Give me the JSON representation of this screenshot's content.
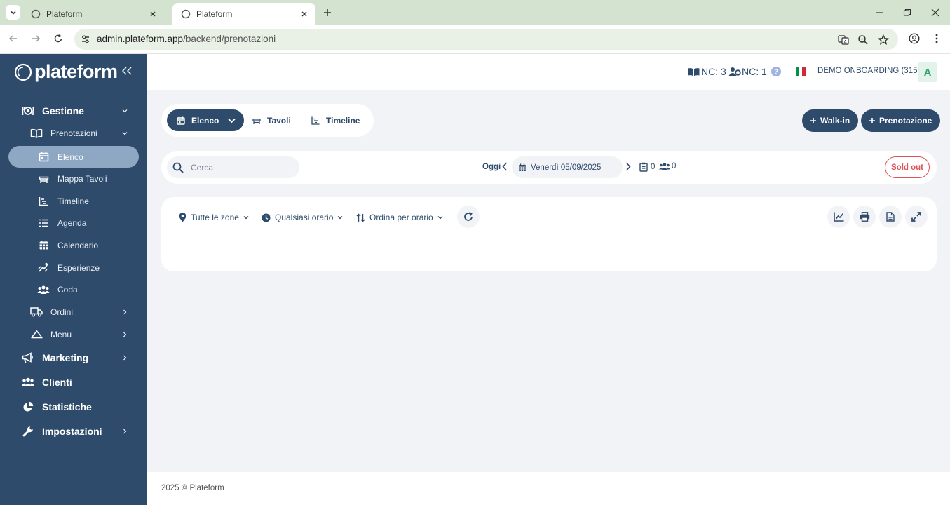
{
  "browser": {
    "tabs": [
      {
        "title": "Plateform"
      },
      {
        "title": "Plateform"
      }
    ],
    "url_host": "admin.plateform.app",
    "url_path": "/backend/prenotazioni"
  },
  "sidebar": {
    "logo": "plateform",
    "items": [
      {
        "label": "Gestione",
        "icon": "cutlery-icon"
      },
      {
        "label": "Prenotazioni",
        "icon": "book-icon"
      },
      {
        "label": "Elenco",
        "icon": "calendar-icon"
      },
      {
        "label": "Mappa Tavoli",
        "icon": "table-icon"
      },
      {
        "label": "Timeline",
        "icon": "timeline-icon"
      },
      {
        "label": "Agenda",
        "icon": "list-icon"
      },
      {
        "label": "Calendario",
        "icon": "calendar-grid-icon"
      },
      {
        "label": "Esperienze",
        "icon": "experience-icon"
      },
      {
        "label": "Coda",
        "icon": "queue-icon"
      },
      {
        "label": "Ordini",
        "icon": "delivery-truck-icon"
      },
      {
        "label": "Menu",
        "icon": "cloche-icon"
      },
      {
        "label": "Marketing",
        "icon": "megaphone-icon"
      },
      {
        "label": "Clienti",
        "icon": "users-icon"
      },
      {
        "label": "Statistiche",
        "icon": "pie-chart-icon"
      },
      {
        "label": "Impostazioni",
        "icon": "wrench-icon"
      }
    ]
  },
  "header": {
    "nc_book": "NC: 3",
    "nc_users": "NC: 1",
    "help": "?",
    "account": "DEMO ONBOARDING (3150)",
    "avatar_letter": "A",
    "flag_colors": [
      "#009246",
      "#ffffff",
      "#ce2b37"
    ]
  },
  "view_tabs": [
    {
      "label": "Elenco"
    },
    {
      "label": "Tavoli"
    },
    {
      "label": "Timeline"
    }
  ],
  "actions": {
    "walkin": "Walk-in",
    "prenotazione": "Prenotazione"
  },
  "search": {
    "placeholder": "Cerca",
    "today": "Oggi",
    "date": "Venerdì 05/09/2025",
    "reservations_count": "0",
    "guests_count": "0",
    "sold_out": "Sold out"
  },
  "filters": {
    "zone": "Tutte le zone",
    "time": "Qualsiasi orario",
    "sort": "Ordina per orario"
  },
  "footer": "2025 © Plateform",
  "colors": {
    "primary": "#2e4b6b",
    "active_nav": "#8ea7c3",
    "danger": "#e0525a",
    "tabstrip": "#d3e3cf"
  }
}
